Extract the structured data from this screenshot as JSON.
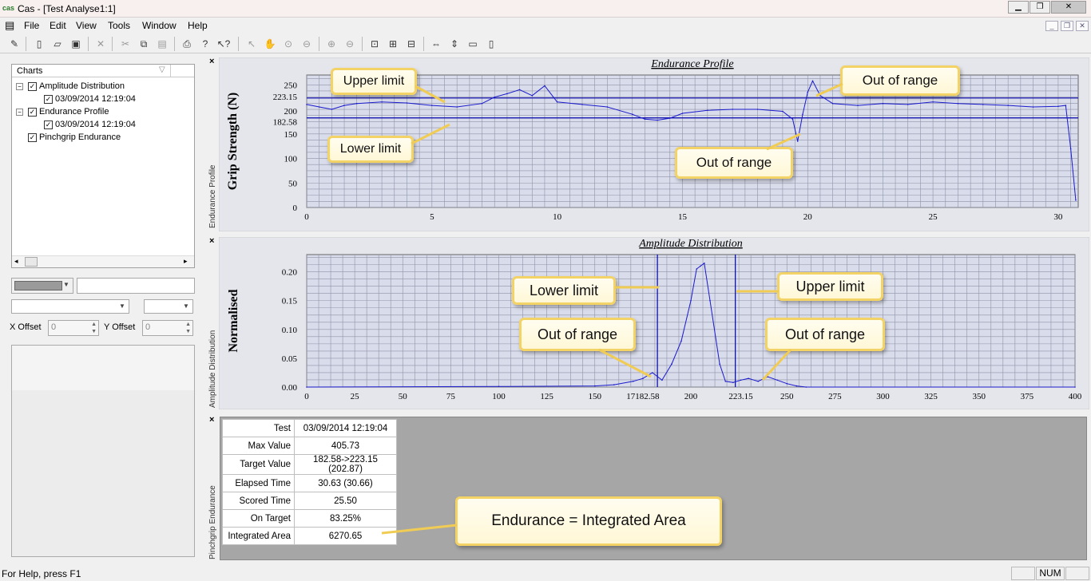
{
  "window": {
    "title": "Cas - [Test Analyse1:1]",
    "app_icon": "cas-logo-icon"
  },
  "menu": [
    "File",
    "Edit",
    "View",
    "Tools",
    "Window",
    "Help"
  ],
  "toolbar_icons": [
    "properties-icon",
    "new-icon",
    "open-icon",
    "save-icon",
    "delete-icon",
    "cut-icon",
    "copy-icon",
    "paste-icon",
    "print-icon",
    "help-icon",
    "context-help-icon",
    "pointer-icon",
    "pan-icon",
    "zoom-icon",
    "zoom-out-icon",
    "zoom-in-icon",
    "zoom-minus-icon",
    "fit-icon",
    "fit-x-icon",
    "fit-y-icon",
    "h-range-icon",
    "v-range-icon",
    "h-expand-icon",
    "v-expand-icon"
  ],
  "left": {
    "tree_header": "Charts",
    "tree": [
      {
        "label": "Amplitude Distribution",
        "level": 0,
        "expander": "−"
      },
      {
        "label": "03/09/2014 12:19:04",
        "level": 1
      },
      {
        "label": "Endurance Profile",
        "level": 0,
        "expander": "−"
      },
      {
        "label": "03/09/2014 12:19:04",
        "level": 1
      },
      {
        "label": "Pinchgrip Endurance",
        "level": 0
      }
    ],
    "x_offset_label": "X Offset",
    "x_offset_value": "0",
    "y_offset_label": "Y Offset",
    "y_offset_value": "0"
  },
  "panes": {
    "endurance_side": "Endurance Profile",
    "amplitude_side": "Amplitude Distribution",
    "pinchgrip_side": "Pinchgrip Endurance"
  },
  "chart_data": [
    {
      "type": "line",
      "title": "Endurance Profile",
      "ylabel": "Grip Strength (N)",
      "xlabel": "",
      "xlim": [
        0,
        30.8
      ],
      "ylim": [
        0,
        270
      ],
      "xticks": [
        0,
        5,
        10,
        15,
        20,
        25,
        30
      ],
      "yticks": [
        "0",
        "50",
        "100",
        "150",
        "182.58",
        "200",
        "223.15",
        "250"
      ],
      "hlines": [
        223.15,
        182.58
      ],
      "grid": true,
      "x": [
        0,
        0.5,
        1,
        1.5,
        2,
        3,
        4,
        5,
        6,
        7,
        7.5,
        8,
        8.5,
        9,
        9.5,
        10,
        11,
        12,
        13,
        13.5,
        14,
        14.5,
        15,
        16,
        17,
        18,
        19,
        19.4,
        19.6,
        19.8,
        20,
        20.2,
        20.5,
        21,
        22,
        23,
        24,
        25,
        26,
        27,
        28,
        29,
        30,
        30.3,
        30.5,
        30.7
      ],
      "values": [
        210,
        205,
        200,
        208,
        212,
        215,
        213,
        208,
        205,
        212,
        225,
        232,
        240,
        228,
        248,
        215,
        210,
        205,
        190,
        180,
        178,
        182,
        192,
        198,
        200,
        200,
        196,
        180,
        135,
        190,
        235,
        258,
        228,
        212,
        208,
        212,
        210,
        215,
        212,
        210,
        208,
        205,
        206,
        208,
        120,
        15
      ]
    },
    {
      "type": "line",
      "title": "Amplitude Distribution",
      "ylabel": "Normalised",
      "xlabel": "",
      "xlim": [
        0,
        400
      ],
      "ylim": [
        0,
        0.23
      ],
      "xticks": [
        "0",
        "25",
        "50",
        "75",
        "100",
        "125",
        "150",
        "17182.58",
        "200",
        "223.15",
        "250",
        "275",
        "300",
        "325",
        "350",
        "375",
        "400"
      ],
      "yticks": [
        "0.00",
        "0.05",
        "0.10",
        "0.15",
        "0.20"
      ],
      "vlines": [
        182.58,
        223.15
      ],
      "grid": true,
      "x": [
        0,
        100,
        150,
        160,
        170,
        175,
        180,
        185,
        190,
        195,
        200,
        203,
        205,
        207,
        210,
        215,
        218,
        222,
        226,
        230,
        235,
        240,
        245,
        250,
        255,
        260,
        400
      ],
      "values": [
        0,
        0.001,
        0.002,
        0.004,
        0.01,
        0.015,
        0.025,
        0.012,
        0.04,
        0.08,
        0.15,
        0.205,
        0.21,
        0.215,
        0.15,
        0.04,
        0.01,
        0.008,
        0.012,
        0.015,
        0.01,
        0.018,
        0.012,
        0.006,
        0.002,
        0,
        0
      ]
    }
  ],
  "callouts": {
    "ep_upper": "Upper limit",
    "ep_lower": "Lower limit",
    "ep_out1": "Out of range",
    "ep_out2": "Out of range",
    "ad_lower": "Lower limit",
    "ad_upper": "Upper limit",
    "ad_out1": "Out of range",
    "ad_out2": "Out of range",
    "table": "Endurance = Integrated Area"
  },
  "results": [
    {
      "k": "Test",
      "v": "03/09/2014 12:19:04"
    },
    {
      "k": "Max Value",
      "v": "405.73"
    },
    {
      "k": "Target Value",
      "v": "182.58->223.15 (202.87)"
    },
    {
      "k": "Elapsed Time",
      "v": "30.63 (30.66)"
    },
    {
      "k": "Scored Time",
      "v": "25.50"
    },
    {
      "k": "On Target",
      "v": "83.25%"
    },
    {
      "k": "Integrated Area",
      "v": "6270.65"
    }
  ],
  "status": {
    "help": "For Help, press F1",
    "num": "NUM"
  }
}
